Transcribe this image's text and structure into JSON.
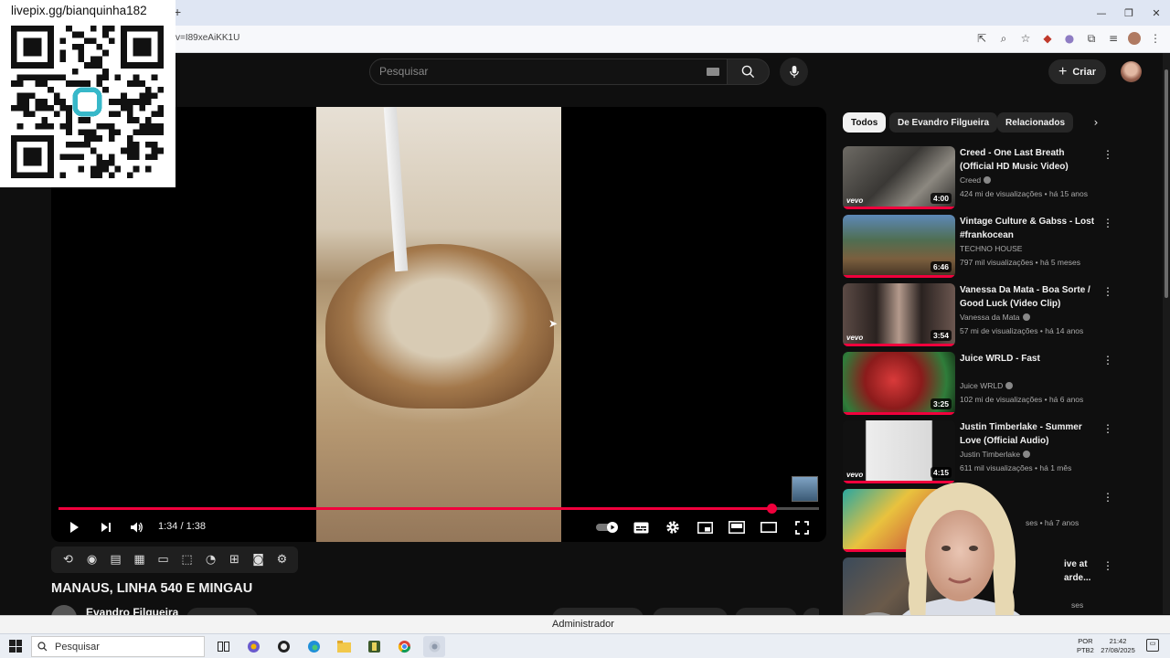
{
  "browser": {
    "url": "v=I89xeAiKK1U",
    "new_tab": "+",
    "win_min": "—",
    "win_restore": "❐",
    "win_close": "✕"
  },
  "overlay": {
    "donation_text": "livepix.gg/bianquinha182"
  },
  "header": {
    "search_placeholder": "Pesquisar",
    "create_label": "Criar"
  },
  "player": {
    "time": "1:34 / 1:38",
    "progress": 0.938
  },
  "video": {
    "title": "MANAUS, LINHA 540 E MINGAU",
    "channel": "Evandro Filgueira"
  },
  "chips": [
    {
      "label": "Todos"
    },
    {
      "label": "De Evandro Filgueira"
    },
    {
      "label": "Relacionados"
    }
  ],
  "recommendations": [
    {
      "title": "Creed - One Last Breath (Official HD Music Video)",
      "channel": "Creed",
      "meta": "424 mi de visualizações • há 15 anos",
      "duration": "4:00",
      "vevo": "vevo"
    },
    {
      "title": "Vintage Culture & Gabss - Lost #frankocean",
      "channel": "TECHNO HOUSE",
      "meta": "797 mil visualizações • há 5 meses",
      "duration": "6:46",
      "vevo": ""
    },
    {
      "title": "Vanessa Da Mata - Boa Sorte / Good Luck (Video Clip)",
      "channel": "Vanessa da Mata",
      "meta": "57 mi de visualizações • há 14 anos",
      "duration": "3:54",
      "vevo": "vevo"
    },
    {
      "title": "Juice WRLD - Fast",
      "channel": "Juice WRLD",
      "meta": "102 mi de visualizações • há 6 anos",
      "duration": "3:25",
      "vevo": ""
    },
    {
      "title": "Justin Timberlake - Summer Love (Official Audio)",
      "channel": "Justin Timberlake",
      "meta": "611 mil visualizações • há 1 mês",
      "duration": "4:15",
      "vevo": "vevo"
    },
    {
      "title": "",
      "channel": "",
      "meta": "ses • há 7 anos",
      "duration": "",
      "vevo": ""
    },
    {
      "title": "ive at arde...",
      "channel": "",
      "meta": "ses",
      "duration": "",
      "vevo": ""
    }
  ],
  "admin_banner": "Administrador",
  "taskbar": {
    "search_label": "Pesquisar",
    "lang_line1": "POR",
    "lang_line2": "PTB2",
    "time": "21:42",
    "date": "27/08/2025"
  }
}
